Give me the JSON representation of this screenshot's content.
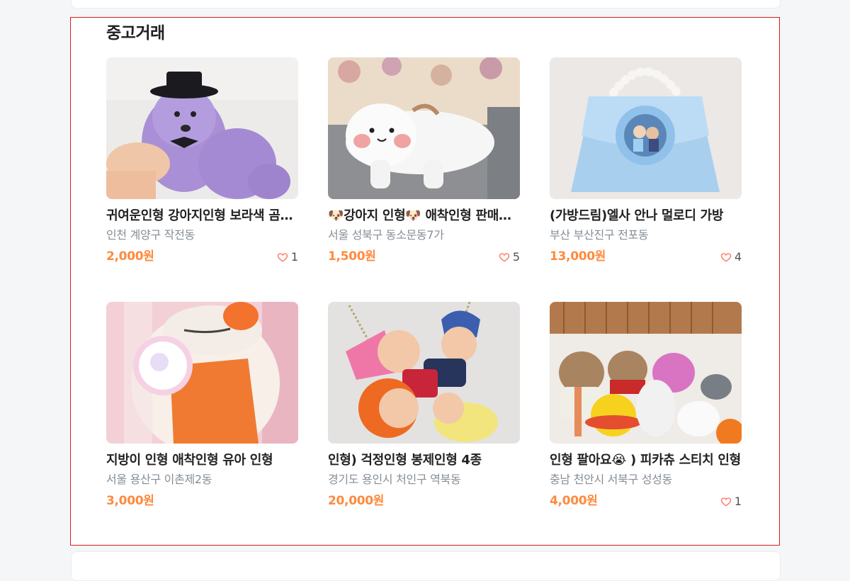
{
  "section": {
    "title": "중고거래"
  },
  "colors": {
    "price": "#ff8a3d",
    "outline": "#d61d1d",
    "region": "#868e96"
  },
  "items": [
    {
      "title": "귀여운인형 강아지인형 보라색 곰인형",
      "region": "인천 계양구 작전동",
      "price": "2,000원",
      "likes": "1",
      "image": "purple-plush-dog"
    },
    {
      "title": "🐶강아지 인형🐶 애착인형 판매합니다",
      "region": "서울 성북구 동소문동7가",
      "price": "1,500원",
      "likes": "5",
      "image": "white-dog-plush"
    },
    {
      "title": "(가방드림)엘사 안나 멀로디 가방",
      "region": "부산 부산진구 전포동",
      "price": "13,000원",
      "likes": "4",
      "image": "frozen-purse"
    },
    {
      "title": "지방이 인형 애착인형 유아 인형",
      "region": "서울 용산구 이촌제2동",
      "price": "3,000원",
      "likes": "",
      "image": "jibangi-plush"
    },
    {
      "title": "인형) 걱정인형 봉제인형 4종",
      "region": "경기도 용인시 처인구 역북동",
      "price": "20,000원",
      "likes": "",
      "image": "worry-dolls"
    },
    {
      "title": "인형 팔아요😭 ) 피카츄 스티치 인형",
      "region": "충남 천안시 서북구 성성동",
      "price": "4,000원",
      "likes": "1",
      "image": "plush-collection"
    }
  ]
}
